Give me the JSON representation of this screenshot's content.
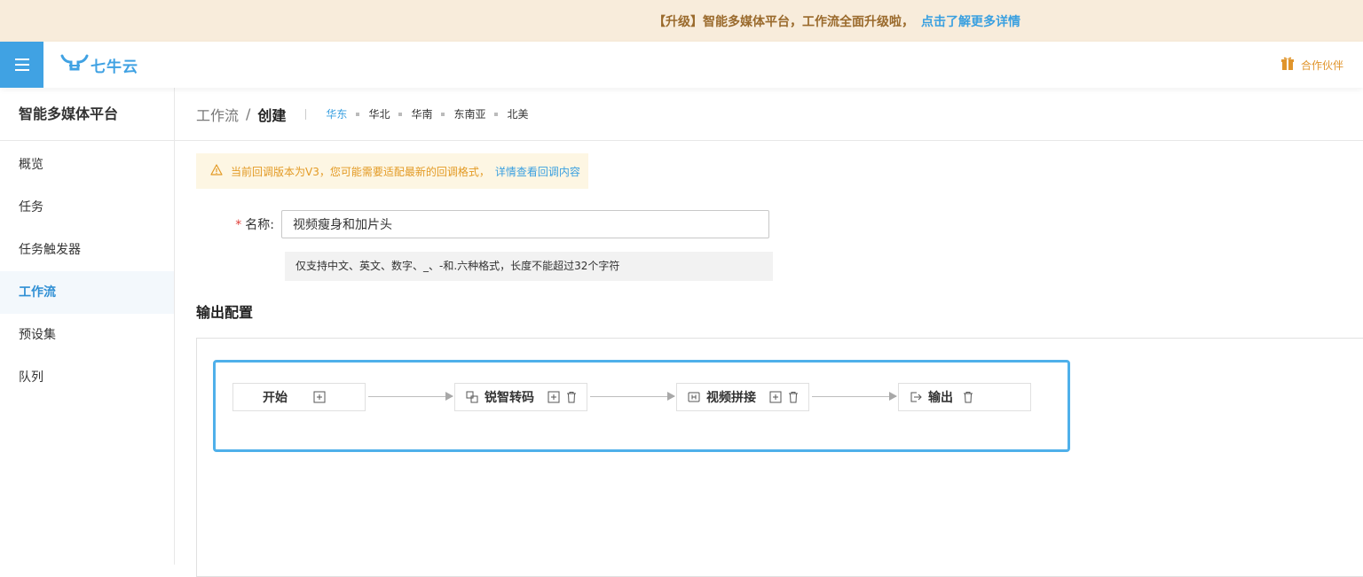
{
  "announcement": {
    "message": "【升级】智能多媒体平台，工作流全面升级啦，",
    "link": "点击了解更多详情"
  },
  "header": {
    "logo_text": "七牛云",
    "partner_label": "合作伙伴"
  },
  "sidebar": {
    "title": "智能多媒体平台",
    "items": [
      {
        "label": "概览"
      },
      {
        "label": "任务"
      },
      {
        "label": "任务触发器"
      },
      {
        "label": "工作流"
      },
      {
        "label": "预设集"
      },
      {
        "label": "队列"
      }
    ],
    "active_index": 3
  },
  "breadcrumb": {
    "parent": "工作流",
    "separator": "/",
    "current": "创建"
  },
  "regions": [
    "华东",
    "华北",
    "华南",
    "东南亚",
    "北美"
  ],
  "notice": {
    "text": "当前回调版本为V3，您可能需要适配最新的回调格式，",
    "link": "详情查看回调内容"
  },
  "form": {
    "name_label": "名称:",
    "required_mark": "*",
    "name_value": "视频瘦身和加片头",
    "hint": "仅支持中文、英文、数字、_、-和.六种格式，长度不能超过32个字符"
  },
  "output_section_title": "输出配置",
  "flow": {
    "nodes": [
      {
        "label": "开始",
        "icon": "none",
        "actions": [
          "add-icon"
        ]
      },
      {
        "label": "锐智转码",
        "icon": "transcode-icon",
        "actions": [
          "add-icon",
          "trash-icon"
        ]
      },
      {
        "label": "视频拼接",
        "icon": "concat-icon",
        "actions": [
          "add-icon",
          "trash-icon"
        ]
      },
      {
        "label": "输出",
        "icon": "export-icon",
        "actions": [
          "trash-icon"
        ]
      }
    ]
  },
  "colors": {
    "brand": "#40a2e3",
    "announcement_bg": "#f8ecdb",
    "warning": "#e39a24",
    "link": "#3aa0e0",
    "flow_border": "#4fb0ea"
  }
}
